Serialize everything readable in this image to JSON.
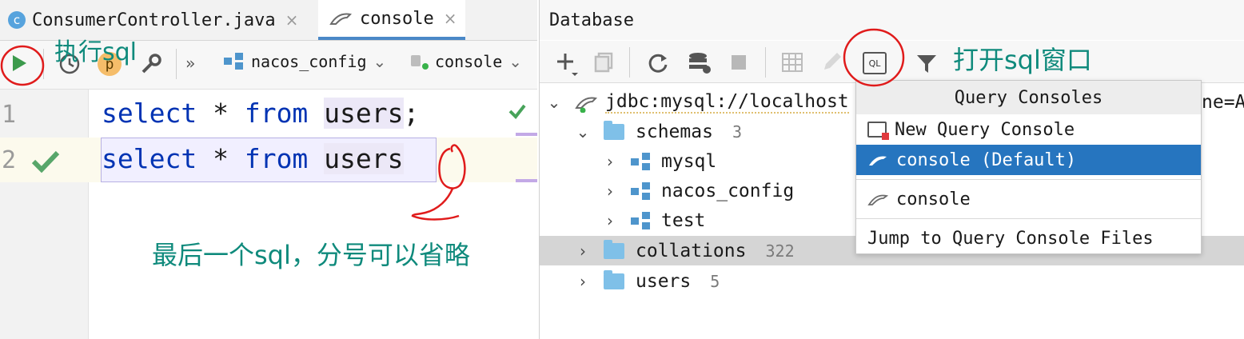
{
  "editor": {
    "tabs": [
      {
        "label": "ConsumerController.java",
        "badge": "c"
      },
      {
        "label": "console"
      }
    ],
    "close_glyph": "×",
    "toolbar": {
      "more_glyph": "»",
      "datasource": "nacos_config",
      "session": "console",
      "params_badge": "p"
    },
    "lines": [
      {
        "num": "1",
        "kw1": "select",
        "mid": " * ",
        "kw2": "from",
        "table": "users",
        "end": ";"
      },
      {
        "num": "2",
        "kw1": "select",
        "mid": " * ",
        "kw2": "from",
        "table": "users",
        "end": ""
      }
    ]
  },
  "annotations": {
    "execute": "执行sql",
    "open_window": "打开sql窗口",
    "note": "最后一个sql，分号可以省略"
  },
  "database": {
    "title": "Database",
    "root": {
      "label": "jdbc:mysql://localhost",
      "tail": "ne=A"
    },
    "schemas": {
      "label": "schemas",
      "count": "3"
    },
    "schema_items": [
      "mysql",
      "nacos_config",
      "test"
    ],
    "collations": {
      "label": "collations",
      "count": "322"
    },
    "users": {
      "label": "users",
      "count": "5"
    }
  },
  "popup": {
    "header": "Query Consoles",
    "new": "New Query Console",
    "default": "console (Default)",
    "console": "console",
    "jump": "Jump to Query Console Files"
  },
  "colors": {
    "accent": "#2675bf",
    "keyword": "#0033b3",
    "annotation": "#0f8a7c",
    "highlight_circle": "#e01b1b",
    "run_green": "#3c9a4c"
  }
}
